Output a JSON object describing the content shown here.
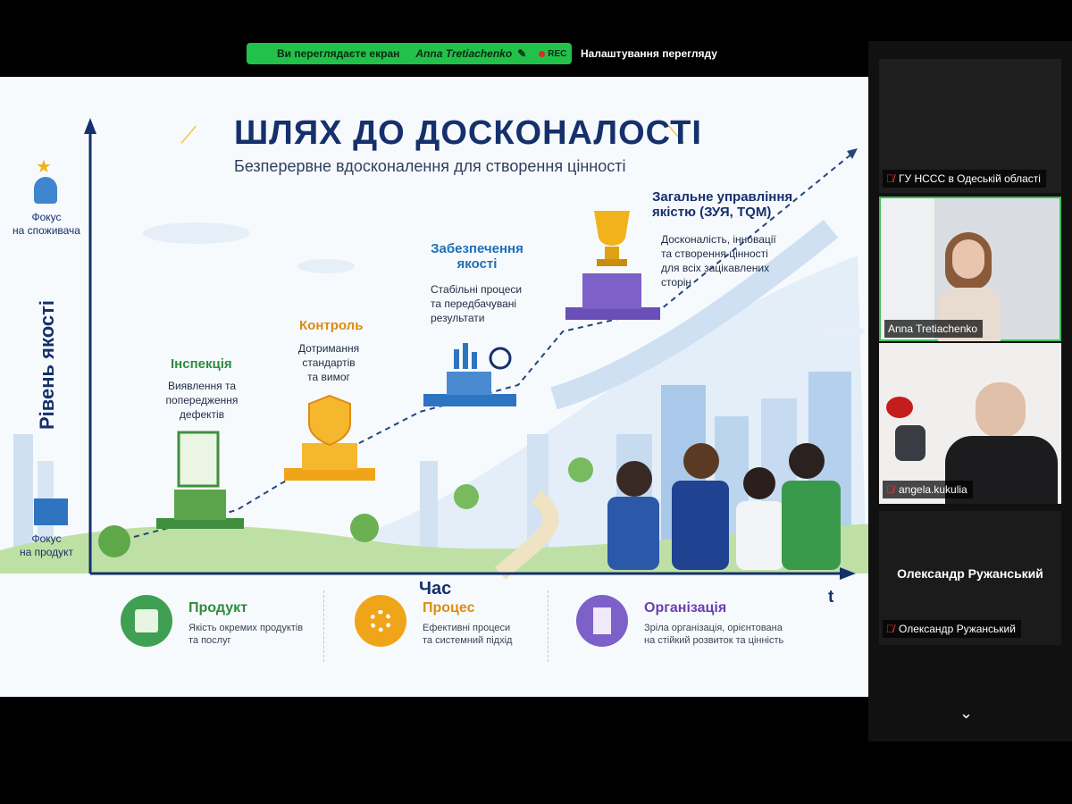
{
  "meeting": {
    "sharing_text": "Ви переглядаєте екран",
    "presenter": "Anna Tretiachenko",
    "rec": "REC",
    "view_settings": "Налаштування перегляду"
  },
  "slide": {
    "title": "ШЛЯХ ДО ДОСКОНАЛОСТІ",
    "subtitle": "Безперервне вдосконалення для створення цінності",
    "y_axis_label": "Рівень якості",
    "y_top_label_line1": "Фокус",
    "y_top_label_line2": "на споживача",
    "y_bottom_label_line1": "Фокус",
    "y_bottom_label_line2": "на продукт",
    "x_axis_label": "Час",
    "x_axis_end": "t",
    "steps": [
      {
        "title": "Інспекція",
        "desc": [
          "Виявлення та",
          "попередження",
          "дефектів"
        ],
        "color": "#2e8b3e"
      },
      {
        "title": "Контроль",
        "desc": [
          "Дотримання",
          "стандартів",
          "та вимог"
        ],
        "color": "#e08a12"
      },
      {
        "title": "Забезпечення",
        "title2": "якості",
        "desc": [
          "Стабільні процеси",
          "та передбачувані",
          "результати"
        ],
        "color": "#1f6fb8"
      },
      {
        "title": "Загальне управління",
        "title2": "якістю (ЗУЯ, TQM)",
        "desc": [
          "Досконалість, інновації",
          "та створення цінності",
          "для всіх зацікавлених",
          "сторін"
        ],
        "color": "#15306b"
      }
    ],
    "legend": [
      {
        "title": "Продукт",
        "desc": [
          "Якість окремих продуктів",
          "та послуг"
        ],
        "color": "#2e8b3e",
        "icon": "box-icon"
      },
      {
        "title": "Процес",
        "desc": [
          "Ефективні процеси",
          "та системний підхід"
        ],
        "color": "#e08a12",
        "icon": "gear-icon"
      },
      {
        "title": "Організація",
        "desc": [
          "Зріла організація, орієнтована",
          "на стійкий розвиток та цінність"
        ],
        "color": "#6a3fb0",
        "icon": "building-icon"
      }
    ]
  },
  "participants": [
    {
      "name": "ГУ НССС в Одеській області",
      "muted": true
    },
    {
      "name": "Anna Tretiachenko",
      "muted": false
    },
    {
      "name": "angela.kukulia",
      "muted": true
    },
    {
      "name": "Олександр Ружанський",
      "muted": true,
      "display": "Олександр Ружанський"
    }
  ]
}
